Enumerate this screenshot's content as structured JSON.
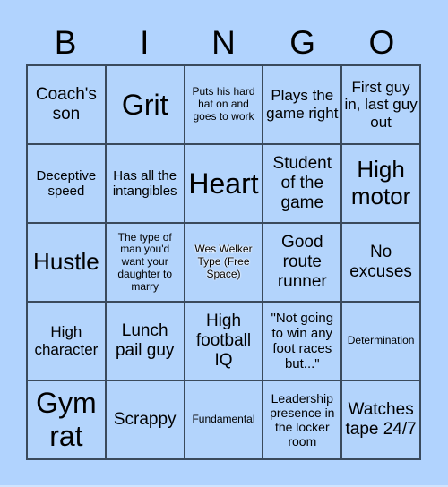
{
  "header": {
    "letters": [
      "B",
      "I",
      "N",
      "G",
      "O"
    ]
  },
  "colors": {
    "background": "#b1d3fe",
    "cell": "#b3d4fc",
    "border": "#3a4a5c"
  },
  "cells": [
    [
      "Coach's son",
      "Grit",
      "Puts his hard hat on and goes to work",
      "Plays the game right",
      "First guy in, last guy out"
    ],
    [
      "Deceptive speed",
      "Has all the intangibles",
      "Heart",
      "Student of the game",
      "High motor"
    ],
    [
      "Hustle",
      "The type of man you'd want your daughter to marry",
      "Wes Welker Type (Free Space)",
      "Good route runner",
      "No excuses"
    ],
    [
      "High character",
      "Lunch pail guy",
      "High football IQ",
      "\"Not going to win any foot races but...\"",
      "Determination"
    ],
    [
      "Gym rat",
      "Scrappy",
      "Fundamental",
      "Leadership presence in the locker room",
      "Watches tape 24/7"
    ]
  ],
  "free_space": {
    "row": 2,
    "col": 2
  }
}
